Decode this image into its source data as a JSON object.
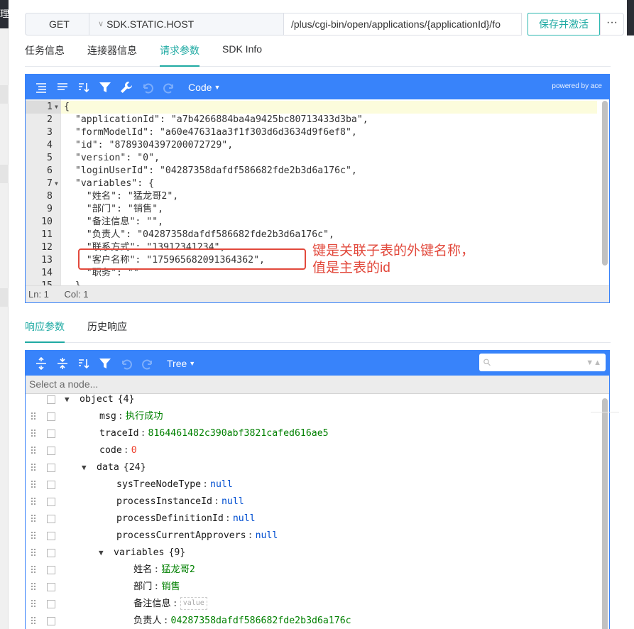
{
  "request": {
    "method": "GET",
    "host": "SDK.STATIC.HOST",
    "path": "/plus/cgi-bin/open/applications/{applicationId}/fo",
    "save_label": "保存并激活",
    "more_label": "···"
  },
  "bg_left_char": "理",
  "tabs1": [
    {
      "label": "任务信息"
    },
    {
      "label": "连接器信息"
    },
    {
      "label": "请求参数"
    },
    {
      "label": "SDK Info"
    }
  ],
  "code_editor": {
    "mode": "Code",
    "powered": "powered by ace",
    "status_ln": "Ln: 1",
    "status_col": "Col: 1",
    "lines": [
      {
        "n": "1",
        "t": "{"
      },
      {
        "n": "2",
        "t": "  \"applicationId\": \"a7b4266884ba4a9425bc80713433d3ba\","
      },
      {
        "n": "3",
        "t": "  \"formModelId\": \"a60e47631aa3f1f303d6d3634d9f6ef8\","
      },
      {
        "n": "4",
        "t": "  \"id\": \"8789304397200072729\","
      },
      {
        "n": "5",
        "t": "  \"version\": \"0\","
      },
      {
        "n": "6",
        "t": "  \"loginUserId\": \"04287358dafdf586682fde2b3d6a176c\","
      },
      {
        "n": "7",
        "t": "  \"variables\": {"
      },
      {
        "n": "8",
        "t": "    \"姓名\": \"猛龙哥2\","
      },
      {
        "n": "9",
        "t": "    \"部门\": \"销售\","
      },
      {
        "n": "10",
        "t": "    \"备注信息\": \"\","
      },
      {
        "n": "11",
        "t": "    \"负责人\": \"04287358dafdf586682fde2b3d6a176c\","
      },
      {
        "n": "12",
        "t": "    \"联系方式\": \"13912341234\","
      },
      {
        "n": "13",
        "t": "    \"客户名称\": \"175965682091364362\","
      },
      {
        "n": "14",
        "t": "    \"职务\": \"\""
      },
      {
        "n": "15",
        "t": "  }"
      }
    ]
  },
  "annotation": {
    "text": "键是关联子表的外键名称，\n值是主表的id",
    "color": "#e2493c"
  },
  "tabs2": [
    {
      "label": "响应参数"
    },
    {
      "label": "历史响应"
    }
  ],
  "tree_editor": {
    "mode": "Tree",
    "navbar": "Select a node...",
    "rows": [
      {
        "key": "object",
        "count": "{4}",
        "toggle": "▼"
      },
      {
        "key": "msg",
        "sep": ":",
        "val": "执行成功",
        "type": "str"
      },
      {
        "key": "traceId",
        "sep": ":",
        "val": "8164461482c390abf3821cafed616ae5",
        "type": "str"
      },
      {
        "key": "code",
        "sep": ":",
        "val": "0",
        "type": "num"
      },
      {
        "key": "data",
        "count": "{24}",
        "toggle": "▼"
      },
      {
        "key": "sysTreeNodeType",
        "sep": ":",
        "val": "null",
        "type": "null"
      },
      {
        "key": "processInstanceId",
        "sep": ":",
        "val": "null",
        "type": "null"
      },
      {
        "key": "processDefinitionId",
        "sep": ":",
        "val": "null",
        "type": "null"
      },
      {
        "key": "processCurrentApprovers",
        "sep": ":",
        "val": "null",
        "type": "null"
      },
      {
        "key": "variables",
        "count": "{9}",
        "toggle": "▼"
      },
      {
        "key": "姓名",
        "sep": ":",
        "val": "猛龙哥2",
        "type": "str"
      },
      {
        "key": "部门",
        "sep": ":",
        "val": "销售",
        "type": "str"
      },
      {
        "key": "备注信息",
        "sep": ":",
        "val": "value",
        "type": "empty"
      },
      {
        "key": "负责人",
        "sep": ":",
        "val": "04287358dafdf586682fde2b3d6a176c",
        "type": "str"
      }
    ]
  },
  "colors": {
    "accent": "#1faaa3",
    "editor_blue": "#3883fa",
    "string_green": "#006000",
    "null_blue": "#004ed0",
    "number_red": "#ee422e"
  }
}
